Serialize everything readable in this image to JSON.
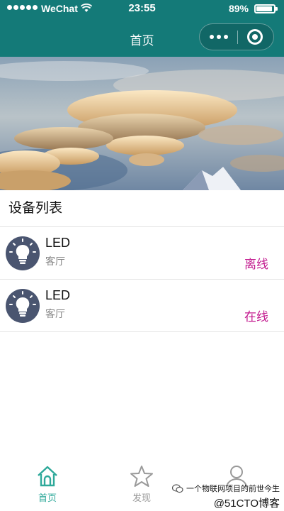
{
  "status_bar": {
    "carrier": "WeChat",
    "time": "23:55",
    "battery_pct": "89%"
  },
  "nav": {
    "title": "首页",
    "more_icon": "ellipsis-icon",
    "close_icon": "target-circle-icon"
  },
  "banner": {
    "slide_count": 3,
    "active_index": 0
  },
  "device_list": {
    "title": "设备列表",
    "items": [
      {
        "name": "LED",
        "room": "客厅",
        "status": "离线",
        "icon": "lightbulb-icon"
      },
      {
        "name": "LED",
        "room": "客厅",
        "status": "在线",
        "icon": "lightbulb-icon"
      }
    ]
  },
  "tabbar": {
    "tabs": [
      {
        "label": "首页",
        "icon": "home-icon",
        "active": true
      },
      {
        "label": "发现",
        "icon": "star-icon",
        "active": false
      },
      {
        "label": "",
        "icon": "user-icon",
        "active": false
      }
    ]
  },
  "watermark": {
    "line1": "一个物联网项目的前世今生",
    "line2": "@51CTO博客"
  },
  "colors": {
    "nav_bg": "#147a78",
    "status_accent": "#c2188e",
    "tab_active": "#2ea99a"
  }
}
